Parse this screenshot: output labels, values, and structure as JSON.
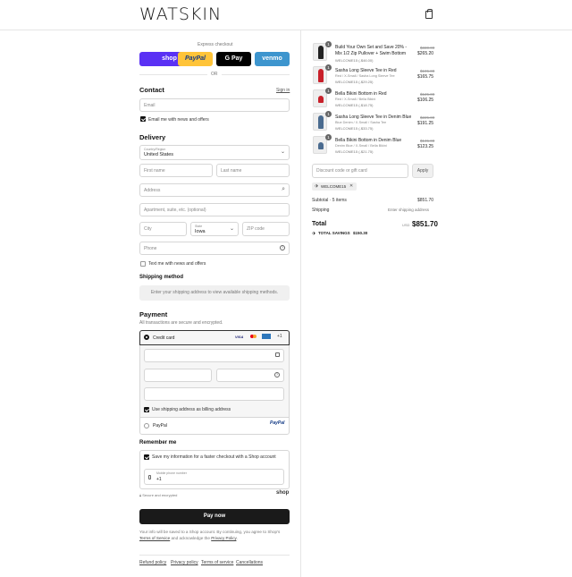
{
  "header": {
    "logo": "WATSKIN"
  },
  "express": {
    "label": "Express checkout",
    "buttons": [
      {
        "label": "shop",
        "color": "#5a31f4"
      },
      {
        "label": "PayPal",
        "color": "#ffc439"
      },
      {
        "label": "G Pay",
        "color": "#000000"
      },
      {
        "label": "venmo",
        "color": "#3d95ce"
      }
    ],
    "or": "OR"
  },
  "contact": {
    "heading": "Contact",
    "sign_in": "Sign in",
    "email_placeholder": "Email",
    "email_news": "Email me with news and offers"
  },
  "delivery": {
    "heading": "Delivery",
    "country_label": "Country/Region",
    "country_value": "United States",
    "first_name": "First name",
    "last_name": "Last name",
    "address": "Address",
    "apartment": "Apartment, suite, etc. (optional)",
    "city": "City",
    "state_label": "State",
    "state_value": "Iowa",
    "zip": "ZIP code",
    "phone": "Phone",
    "text_news": "Text me with news and offers"
  },
  "shipping": {
    "heading": "Shipping method",
    "message": "Enter your shipping address to view available shipping methods."
  },
  "payment": {
    "heading": "Payment",
    "sub": "All transactions are secure and encrypted.",
    "credit_card": "Credit card",
    "billing_same": "Use shipping address as billing address",
    "paypal": "PayPal",
    "paypal_logo": "PayPal"
  },
  "remember": {
    "heading": "Remember me",
    "save_info": "Save my information for a faster checkout with a Shop account",
    "mobile_label": "Mobile phone number",
    "mobile_value": "+1",
    "secure": "Secure and encrypted",
    "shop": "shop"
  },
  "pay_button": "Pay now",
  "legal": {
    "line1": "Your info will be saved to a Shop account. By continuing, you agree to Shop's",
    "tos": "Terms of Service",
    "and": "and acknowledge the",
    "privacy": "Privacy Policy"
  },
  "footer_links": [
    "Refund policy",
    "Privacy policy",
    "Terms of service",
    "Cancellations"
  ],
  "order": {
    "items": [
      {
        "qty": "1",
        "name": "Build Your Own Set and Save 20% - Mix 1/2 Zip Pullover + Swim Bottom",
        "variant": "",
        "discount": "WELCOME15 (-$46.00)",
        "orig": "$330.00",
        "price": "$265.20"
      },
      {
        "qty": "1",
        "name": "Sasha Long Sleeve Tee in Red",
        "variant": "Red / X-Small / Sasha Long Sleeve Tee",
        "discount": "WELCOME15 (-$29.25)",
        "orig": "$195.00",
        "price": "$165.75"
      },
      {
        "qty": "1",
        "name": "Bella Bikini Bottom in Red",
        "variant": "Red / X-Small / Bella Bikini",
        "discount": "WELCOME15 (-$18.75)",
        "orig": "$125.00",
        "price": "$106.25"
      },
      {
        "qty": "1",
        "name": "Sasha Long Sleeve Tee in Denim Blue",
        "variant": "Blue Denim / X-Small / Sasha Tee",
        "discount": "WELCOME15 (-$33.75)",
        "orig": "$225.00",
        "price": "$191.25"
      },
      {
        "qty": "1",
        "name": "Bella Bikini Bottom in Denim Blue",
        "variant": "Denim Blue / X-Small / Bella Bikini",
        "discount": "WELCOME15 (-$21.75)",
        "orig": "$145.00",
        "price": "$123.25"
      }
    ],
    "discount_placeholder": "Discount code or gift card",
    "apply": "Apply",
    "applied_code": "WELCOME15",
    "subtotal_label": "Subtotal · 5 items",
    "subtotal": "$851.70",
    "shipping_label": "Shipping",
    "shipping_value": "Enter shipping address",
    "total_label": "Total",
    "currency": "USD",
    "total": "$851.70",
    "savings_label": "TOTAL SAVINGS",
    "savings": "$150.30"
  }
}
